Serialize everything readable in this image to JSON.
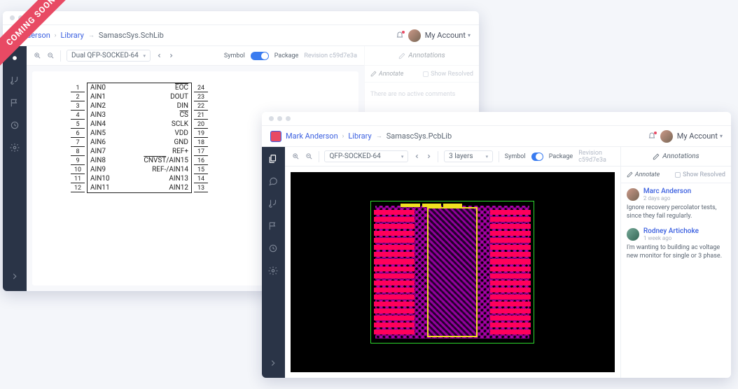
{
  "ribbon": "COMING SOON",
  "back": {
    "breadcrumb": {
      "user_partial": "derson",
      "lib": "Library",
      "file": "SamascSys.SchLib"
    },
    "account": "My Account",
    "toolbar": {
      "component": "Dual QFP-SOCKED-64",
      "symbol": "Symbol",
      "package": "Package",
      "revision": "Revision c59d7e3a"
    },
    "anno": {
      "title": "Annotations",
      "annotate": "Annotate",
      "show_resolved": "Show Resolved",
      "empty": "There are no active comments"
    },
    "schematic": {
      "left": [
        {
          "n": "1",
          "l": "AIN0"
        },
        {
          "n": "2",
          "l": "AIN1"
        },
        {
          "n": "3",
          "l": "AIN2"
        },
        {
          "n": "4",
          "l": "AIN3"
        },
        {
          "n": "5",
          "l": "AIN4"
        },
        {
          "n": "6",
          "l": "AIN5"
        },
        {
          "n": "7",
          "l": "AIN6"
        },
        {
          "n": "8",
          "l": "AIN7"
        },
        {
          "n": "9",
          "l": "AIN8"
        },
        {
          "n": "10",
          "l": "AIN9"
        },
        {
          "n": "11",
          "l": "AIN10"
        },
        {
          "n": "12",
          "l": "AIN11"
        }
      ],
      "right": [
        {
          "n": "24",
          "l": "EOC",
          "ov": true
        },
        {
          "n": "23",
          "l": "DOUT"
        },
        {
          "n": "22",
          "l": "DIN"
        },
        {
          "n": "21",
          "l": "CS",
          "ov": true
        },
        {
          "n": "20",
          "l": "SCLK"
        },
        {
          "n": "19",
          "l": "VDD"
        },
        {
          "n": "18",
          "l": "GND"
        },
        {
          "n": "17",
          "l": "REF+"
        },
        {
          "n": "16",
          "l": "CNVST/AIN15",
          "ovp": true
        },
        {
          "n": "15",
          "l": "REF-/AIN14"
        },
        {
          "n": "14",
          "l": "AIN13"
        },
        {
          "n": "13",
          "l": "AIN12"
        }
      ]
    }
  },
  "front": {
    "breadcrumb": {
      "user": "Mark Anderson",
      "lib": "Library",
      "file": "SamascSys.PcbLib"
    },
    "account": "My Account",
    "toolbar": {
      "component": "QFP-SOCKED-64",
      "layers": "3 layers",
      "symbol": "Symbol",
      "package": "Package",
      "revision": "Revision c59d7e3a"
    },
    "anno": {
      "title": "Annotations",
      "annotate": "Annotate",
      "show_resolved": "Show Resolved",
      "comments": [
        {
          "author": "Marc Anderson",
          "time": "2 days ago",
          "body": "Ignore recovery percolator tests, since they fail regularly."
        },
        {
          "author": "Rodney Artichoke",
          "time": "1 week ago",
          "body": "I'm wanting to building ac voltage new monitor for single or 3 phase."
        }
      ]
    }
  }
}
